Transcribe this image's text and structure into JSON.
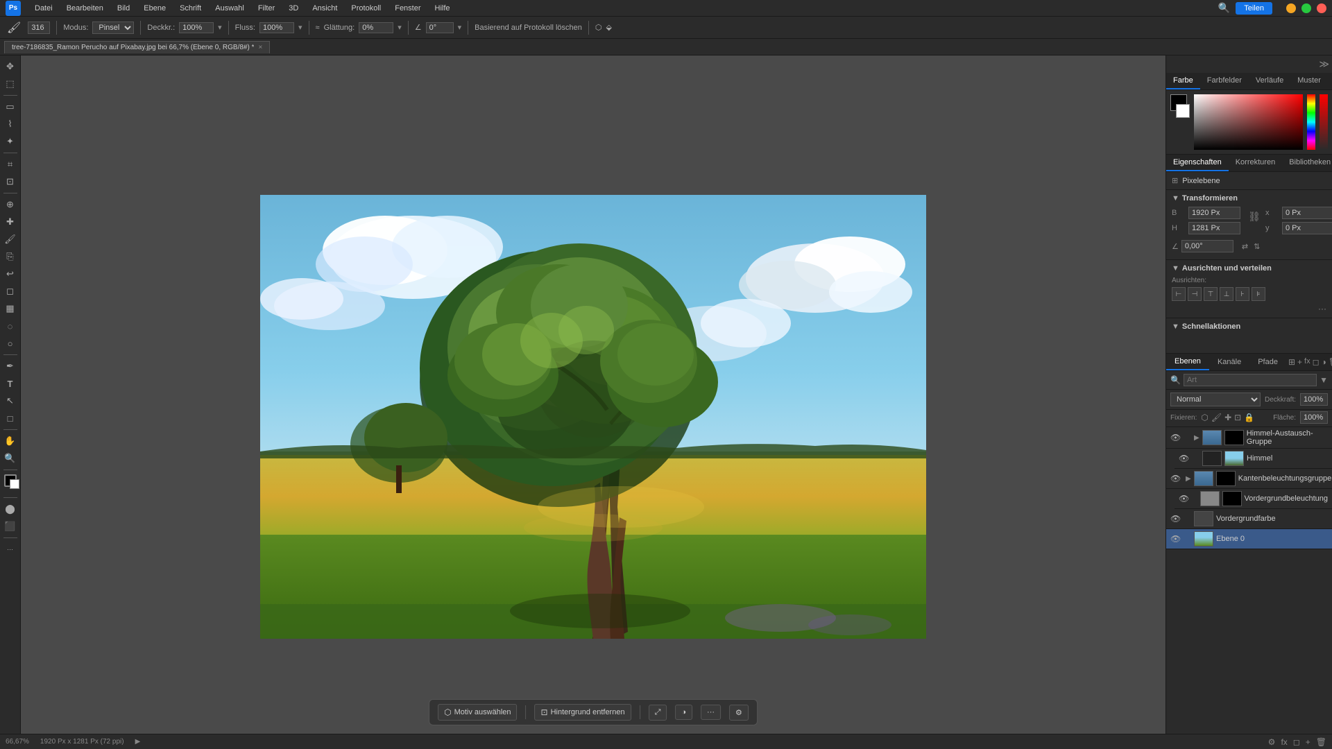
{
  "app": {
    "title": "Adobe Photoshop",
    "logo": "Ps"
  },
  "menubar": {
    "items": [
      "Datei",
      "Bearbeiten",
      "Bild",
      "Ebene",
      "Schrift",
      "Auswahl",
      "Filter",
      "3D",
      "Ansicht",
      "Protokoll",
      "Fenster",
      "Hilfe"
    ],
    "teilen_label": "Teilen",
    "window_controls": [
      "—",
      "□",
      "✕"
    ]
  },
  "toolbar": {
    "modus_label": "Modus:",
    "modus_value": "Pinsel",
    "deckkr_label": "Deckkr.:",
    "deckkr_value": "100%",
    "fluss_label": "Fluss:",
    "fluss_value": "100%",
    "glattung_label": "Glättung:",
    "glattung_value": "0%",
    "angle_value": "0°",
    "basierend_label": "Basierend auf Protokoll löschen",
    "brush_size": "316"
  },
  "tab": {
    "label": "tree-7186835_Ramon Perucho auf Pixabay.jpg bei 66,7% (Ebene 0, RGB/8#) *",
    "close": "×"
  },
  "statusbar": {
    "zoom": "66,67%",
    "dimensions": "1920 Px x 1281 Px (72 ppi)",
    "arrow": "▶"
  },
  "bottom_toolbar": {
    "motiv_label": "Motiv auswählen",
    "hintergrund_label": "Hintergrund entfernen",
    "more": "···"
  },
  "right_panel": {
    "color_tabs": [
      "Farbe",
      "Farbfelder",
      "Verläufe",
      "Muster"
    ],
    "properties_tabs": [
      "Eigenschaften",
      "Korrekturen",
      "Bibliotheken"
    ],
    "pixel_ebene_label": "Pixelebene",
    "transformieren_label": "Transformieren",
    "transform": {
      "B_label": "B",
      "B_value": "1920 Px",
      "x_label": "x",
      "x_value": "0 Px",
      "H_label": "H",
      "H_value": "1281 Px",
      "y_label": "y",
      "y_value": "0 Px",
      "angle_value": "0,00°"
    },
    "ausrichten_label": "Ausrichten und verteilen",
    "ausrichten_sub": "Ausrichten:",
    "schnell_label": "Schnellaktionen",
    "layers_tabs": [
      "Ebenen",
      "Kanäle",
      "Pfade"
    ],
    "search_placeholder": "Art",
    "blend_mode": "Normal",
    "deckkraft_label": "Deckkraft:",
    "deckkraft_value": "100%",
    "flache_label": "Fläche:",
    "flache_value": "100%",
    "fixieren_label": "Fixieren:",
    "layers": [
      {
        "id": "group1",
        "name": "Himmel-Austausch-Gruppe",
        "type": "group",
        "visible": true,
        "indent": 0
      },
      {
        "id": "himmel",
        "name": "Himmel",
        "type": "layer",
        "visible": true,
        "indent": 1,
        "thumb": "sky"
      },
      {
        "id": "group2",
        "name": "Kantenbeleuchtungsgruppe",
        "type": "group",
        "visible": true,
        "indent": 0
      },
      {
        "id": "vordergrund",
        "name": "Vordergrundbeleuchtung",
        "type": "layer",
        "visible": true,
        "indent": 1,
        "thumb": "gray"
      },
      {
        "id": "vordergrundfarbe",
        "name": "Vordergrundfarbe",
        "type": "layer",
        "visible": true,
        "indent": 0,
        "thumb": "black"
      },
      {
        "id": "ebene0",
        "name": "Ebene 0",
        "type": "layer",
        "visible": true,
        "indent": 0,
        "thumb": "scene",
        "active": true
      }
    ]
  }
}
